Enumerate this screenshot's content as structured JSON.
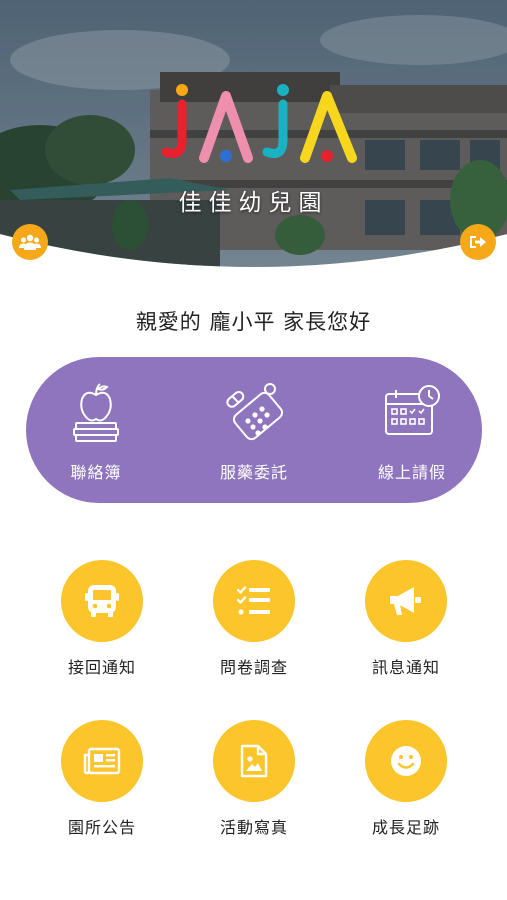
{
  "header": {
    "brand_title": "佳佳幼兒園",
    "left_button_icon": "group-icon",
    "right_button_icon": "logout-icon"
  },
  "greeting": "親愛的 龐小平 家長您好",
  "featured": [
    {
      "label": "聯絡簿",
      "icon": "apple-books-icon"
    },
    {
      "label": "服藥委託",
      "icon": "pills-icon"
    },
    {
      "label": "線上請假",
      "icon": "calendar-clock-icon"
    }
  ],
  "grid": [
    {
      "label": "接回通知",
      "icon": "bus-icon"
    },
    {
      "label": "問卷調查",
      "icon": "checklist-icon"
    },
    {
      "label": "訊息通知",
      "icon": "megaphone-icon"
    },
    {
      "label": "園所公告",
      "icon": "newspaper-icon"
    },
    {
      "label": "活動寫真",
      "icon": "photo-file-icon"
    },
    {
      "label": "成長足跡",
      "icon": "smile-icon"
    }
  ],
  "colors": {
    "accent_orange": "#f7a818",
    "purple": "#8f75bd",
    "yellow": "#fcc52c"
  }
}
